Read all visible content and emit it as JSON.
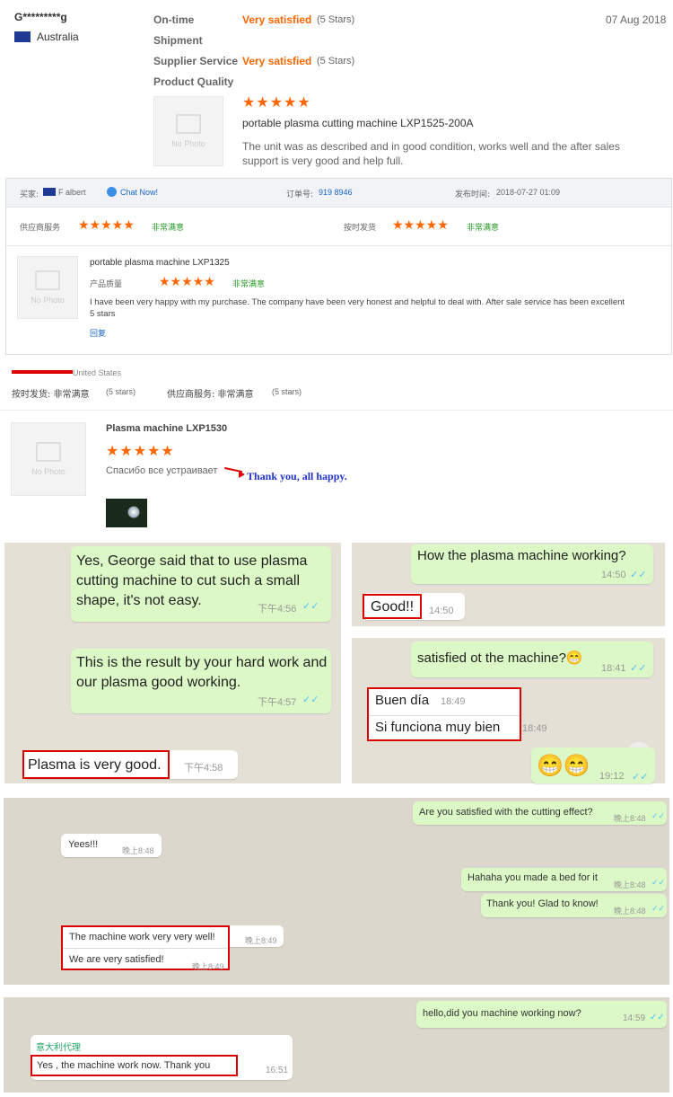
{
  "review1": {
    "user": "G*********g",
    "country": "Australia",
    "date": "07 Aug 2018",
    "rows": [
      {
        "label": "On-time",
        "value": "Very satisfied",
        "stars": "(5 Stars)"
      },
      {
        "label": "Shipment",
        "value": "",
        "stars": ""
      },
      {
        "label": "Supplier Service",
        "value": "Very satisfied",
        "stars": "(5 Stars)"
      },
      {
        "label": "Product Quality",
        "value": "",
        "stars": ""
      }
    ],
    "rating": "★★★★★",
    "product": "portable plasma cutting machine LXP1525-200A",
    "comment": "The unit was as described and in good condition, works well and the after sales support is very good and help full.",
    "nophoto": "No Photo"
  },
  "review2": {
    "buyer_label": "买家:",
    "buyer_name": "F        albert",
    "chat_now": "Chat Now!",
    "order_label": "订单号:",
    "order_no": "919            8946",
    "time_label": "发布时间:",
    "time_value": "2018-07-27 01:09",
    "supplier_label": "供应商服务",
    "supplier_rating": "★★★★★",
    "supplier_value": "非常满意",
    "delivery_label": "按时发货",
    "delivery_rating": "★★★★★",
    "delivery_value": "非常满意",
    "product": "portable plasma machine LXP1325",
    "quality_label": "产品质量",
    "quality_rating": "★★★★★",
    "quality_value": "非常满意",
    "comment": "I have been very happy with my purchase. The company have been very honest and helpful to deal with. After sale service has been excellent 5 stars",
    "reply": "回复",
    "nophoto": "No Photo"
  },
  "review3": {
    "country": "United States",
    "line": "按时发货: 非常满意",
    "line_stars": "(5 stars)",
    "line2": "供应商服务: 非常满意",
    "line2_stars": "(5 stars)",
    "product": "Plasma machine LXP1530",
    "rating": "★★★★★",
    "comment_ru": "Спасибо все устраивает",
    "translation": "Thank you, all happy.",
    "nophoto": "No Photo"
  },
  "chat1": {
    "m1": "Yes, George said that to use plasma cutting machine to cut such a small shape, it's not easy.",
    "m1_time": "下午4:56",
    "m2": "This is the result by your hard work and our plasma good working.",
    "m2_time": "下午4:57",
    "m3": "Plasma is very good.",
    "m3_time": "下午4:58"
  },
  "chat2": {
    "m1": "How the plasma machine working?",
    "m1_time": "14:50",
    "m2": "Good!!",
    "m2_time": "14:50"
  },
  "chat3": {
    "m1": "satisfied ot the machine?😁",
    "m1_time": "18:41",
    "m2": "Buen día",
    "m2_time": "18:49",
    "m3": "Si funciona muy bien",
    "m3_time": "18:49",
    "m4": "😁😁",
    "m4_time": "19:12"
  },
  "chat4": {
    "m1": "Are you satisfied with the cutting effect?",
    "m1_time": "晚上8:48",
    "m2": "Yees!!!",
    "m2_time": "晚上8:48",
    "m3": "Hahaha you made a bed for it",
    "m3_time": "晚上8:48",
    "m4": "Thank you! Glad to know!",
    "m4_time": "晚上8:48",
    "m5": "The machine work very very well!",
    "m5_time": "晚上8:49",
    "m6": "We are very satisfied!",
    "m6_time": "晚上8:49"
  },
  "chat5": {
    "m1": "hello,did you machine working now?",
    "m1_time": "14:59",
    "sender": "意大利代理",
    "m2": "Yes , the machine work now. Thank you",
    "m2_time": "16:51"
  },
  "colors": {
    "accent": "#ff6600",
    "link": "#1a66cc",
    "bubble_out": "#dcf8c6",
    "highlight": "#dd0000"
  }
}
